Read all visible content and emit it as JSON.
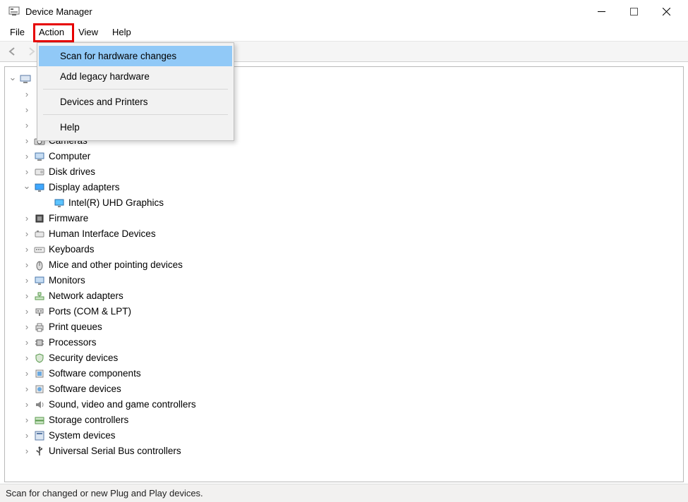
{
  "window": {
    "title": "Device Manager"
  },
  "menubar": {
    "file": "File",
    "action": "Action",
    "view": "View",
    "help": "Help"
  },
  "dropdown": {
    "scan": "Scan for hardware changes",
    "add_legacy": "Add legacy hardware",
    "devices_printers": "Devices and Printers",
    "help": "Help"
  },
  "tree": {
    "root": "",
    "items": [
      {
        "label": "Cameras",
        "icon": "camera-icon"
      },
      {
        "label": "Computer",
        "icon": "computer-icon"
      },
      {
        "label": "Disk drives",
        "icon": "disk-icon"
      },
      {
        "label": "Display adapters",
        "icon": "display-icon",
        "expanded": true,
        "children": [
          {
            "label": "Intel(R) UHD Graphics",
            "icon": "gpu-icon"
          }
        ]
      },
      {
        "label": "Firmware",
        "icon": "firmware-icon"
      },
      {
        "label": "Human Interface Devices",
        "icon": "hid-icon"
      },
      {
        "label": "Keyboards",
        "icon": "keyboard-icon"
      },
      {
        "label": "Mice and other pointing devices",
        "icon": "mouse-icon"
      },
      {
        "label": "Monitors",
        "icon": "monitor-icon"
      },
      {
        "label": "Network adapters",
        "icon": "network-icon"
      },
      {
        "label": "Ports (COM & LPT)",
        "icon": "ports-icon"
      },
      {
        "label": "Print queues",
        "icon": "printer-icon"
      },
      {
        "label": "Processors",
        "icon": "cpu-icon"
      },
      {
        "label": "Security devices",
        "icon": "security-icon"
      },
      {
        "label": "Software components",
        "icon": "software-comp-icon"
      },
      {
        "label": "Software devices",
        "icon": "software-dev-icon"
      },
      {
        "label": "Sound, video and game controllers",
        "icon": "sound-icon"
      },
      {
        "label": "Storage controllers",
        "icon": "storage-icon"
      },
      {
        "label": "System devices",
        "icon": "system-icon"
      },
      {
        "label": "Universal Serial Bus controllers",
        "icon": "usb-icon"
      }
    ]
  },
  "statusbar": {
    "text": "Scan for changed or new Plug and Play devices."
  },
  "highlights": {
    "action_menu": true,
    "scan_item": true
  }
}
